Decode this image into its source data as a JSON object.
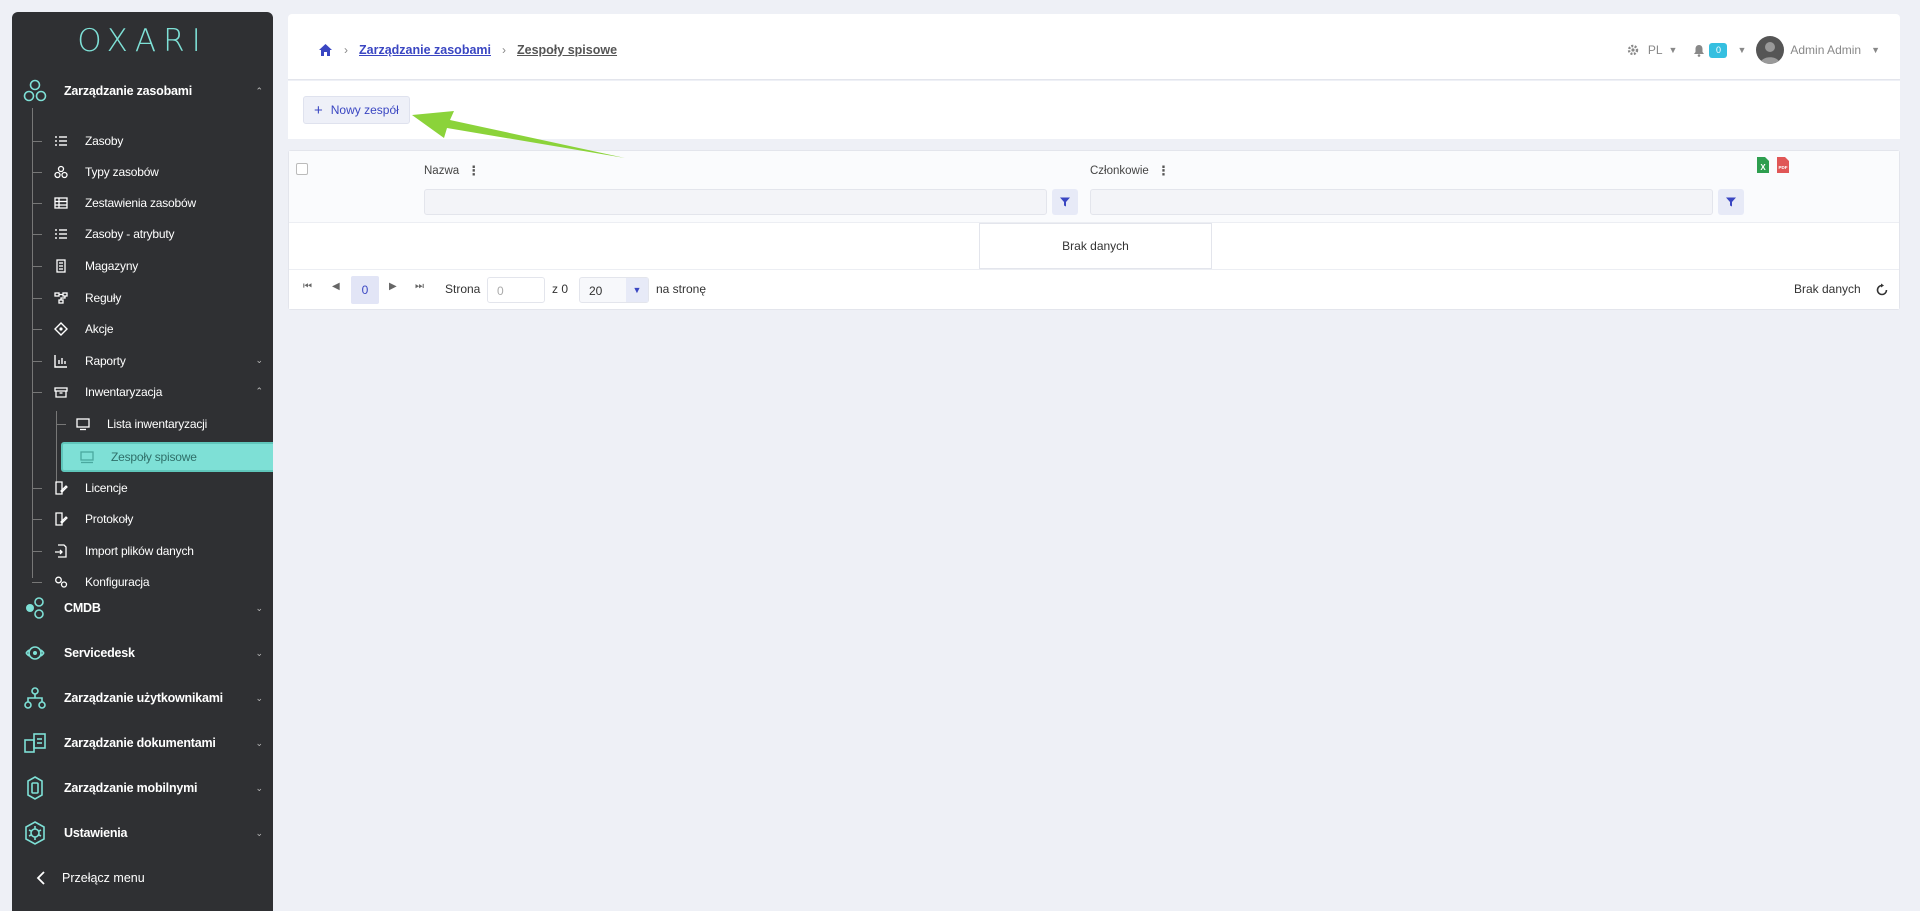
{
  "brand": {
    "logo_text": "OXARI"
  },
  "sidebar": {
    "section_main": "Zarządzanie zasobami",
    "items": [
      {
        "label": "Zasoby",
        "icon": "list-icon"
      },
      {
        "label": "Typy zasobów",
        "icon": "shapes-icon"
      },
      {
        "label": "Zestawienia zasobów",
        "icon": "table-icon"
      },
      {
        "label": "Zasoby - atrybuty",
        "icon": "list-icon"
      },
      {
        "label": "Magazyny",
        "icon": "building-icon"
      },
      {
        "label": "Reguły",
        "icon": "flow-icon"
      },
      {
        "label": "Akcje",
        "icon": "diamond-icon"
      },
      {
        "label": "Raporty",
        "icon": "chart-icon"
      },
      {
        "label": "Inwentaryzacja",
        "icon": "box-icon"
      },
      {
        "label": "Lista inwentaryzacji",
        "icon": "monitor-icon"
      },
      {
        "label": "Zespoły spisowe",
        "icon": "team-icon"
      },
      {
        "label": "Licencje",
        "icon": "edit-doc-icon"
      },
      {
        "label": "Protokoły",
        "icon": "edit-doc-icon"
      },
      {
        "label": "Import plików danych",
        "icon": "import-icon"
      },
      {
        "label": "Konfiguracja",
        "icon": "gears-icon"
      }
    ],
    "sections": [
      {
        "label": "CMDB",
        "icon": "cmdb-icon"
      },
      {
        "label": "Servicedesk",
        "icon": "headset-icon"
      },
      {
        "label": "Zarządzanie użytkownikami",
        "icon": "users-tree-icon"
      },
      {
        "label": "Zarządzanie dokumentami",
        "icon": "documents-icon"
      },
      {
        "label": "Zarządzanie mobilnymi",
        "icon": "mobile-icon"
      },
      {
        "label": "Ustawienia",
        "icon": "settings-hex-icon"
      }
    ],
    "toggle_label": "Przełącz menu"
  },
  "header": {
    "breadcrumb": {
      "parent": "Zarządzanie zasobami",
      "current": "Zespoły spisowe"
    },
    "language": "PL",
    "notifications_count": "0",
    "user_name": "Admin Admin"
  },
  "toolbar": {
    "new_label": "Nowy zespół"
  },
  "grid": {
    "columns": [
      {
        "label": "Nazwa"
      },
      {
        "label": "Członkowie"
      }
    ],
    "empty_text": "Brak danych"
  },
  "pager": {
    "current_page": "0",
    "page_label": "Strona",
    "page_input_value": "0",
    "of_label": "z 0",
    "page_size": "20",
    "per_page_label": "na stronę",
    "status_text": "Brak danych"
  },
  "colors": {
    "accent": "#7ee0d6",
    "primary": "#3a46c2",
    "sidebar_bg": "#2f3033",
    "arrow": "#8bd33a"
  }
}
